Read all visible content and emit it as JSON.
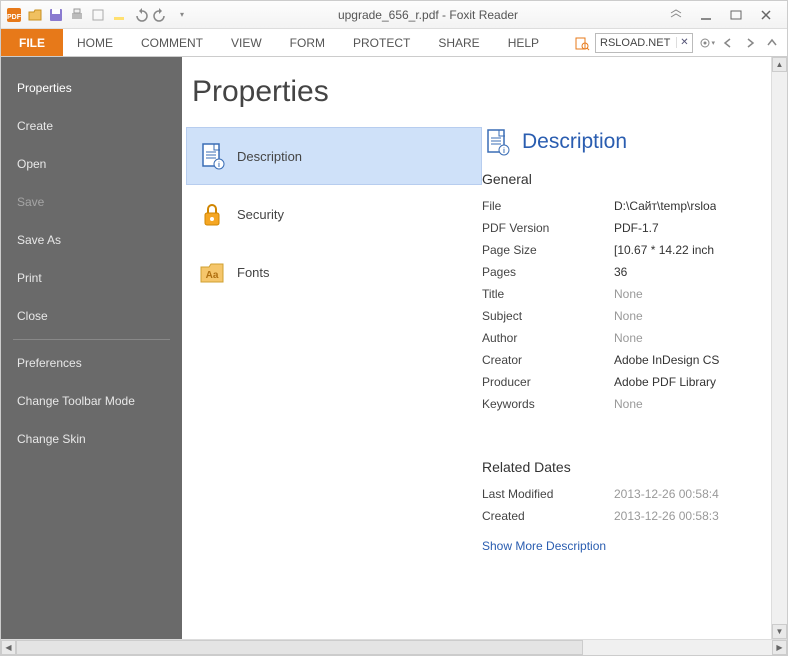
{
  "window": {
    "title": "upgrade_656_r.pdf - Foxit Reader"
  },
  "ribbon": {
    "tabs": [
      "FILE",
      "HOME",
      "COMMENT",
      "VIEW",
      "FORM",
      "PROTECT",
      "SHARE",
      "HELP"
    ],
    "search_value": "RSLOAD.NET"
  },
  "sidebar": {
    "items": [
      {
        "label": "Properties",
        "disabled": false,
        "active": true
      },
      {
        "label": "Create",
        "disabled": false
      },
      {
        "label": "Open",
        "disabled": false
      },
      {
        "label": "Save",
        "disabled": true
      },
      {
        "label": "Save As",
        "disabled": false
      },
      {
        "label": "Print",
        "disabled": false
      },
      {
        "label": "Close",
        "disabled": false
      }
    ],
    "items2": [
      {
        "label": "Preferences"
      },
      {
        "label": "Change Toolbar Mode"
      },
      {
        "label": "Change Skin"
      }
    ]
  },
  "main": {
    "title": "Properties",
    "categories": [
      {
        "label": "Description",
        "selected": true
      },
      {
        "label": "Security",
        "selected": false
      },
      {
        "label": "Fonts",
        "selected": false
      }
    ],
    "detail": {
      "heading": "Description",
      "general_title": "General",
      "general": [
        {
          "key": "File",
          "val": "D:\\Сайт\\temp\\rsloa",
          "muted": false
        },
        {
          "key": "PDF Version",
          "val": "PDF-1.7",
          "muted": false
        },
        {
          "key": "Page Size",
          "val": "[10.67 * 14.22 inch",
          "muted": false
        },
        {
          "key": "Pages",
          "val": "36",
          "muted": false
        },
        {
          "key": "Title",
          "val": "None",
          "muted": true
        },
        {
          "key": "Subject",
          "val": "None",
          "muted": true
        },
        {
          "key": "Author",
          "val": "None",
          "muted": true
        },
        {
          "key": "Creator",
          "val": "Adobe InDesign CS",
          "muted": false
        },
        {
          "key": "Producer",
          "val": "Adobe PDF Library",
          "muted": false
        },
        {
          "key": "Keywords",
          "val": "None",
          "muted": true
        }
      ],
      "dates_title": "Related Dates",
      "dates": [
        {
          "key": "Last Modified",
          "val": "2013-12-26 00:58:4",
          "muted": true
        },
        {
          "key": "Created",
          "val": "2013-12-26 00:58:3",
          "muted": true
        }
      ],
      "show_more": "Show More Description"
    }
  }
}
